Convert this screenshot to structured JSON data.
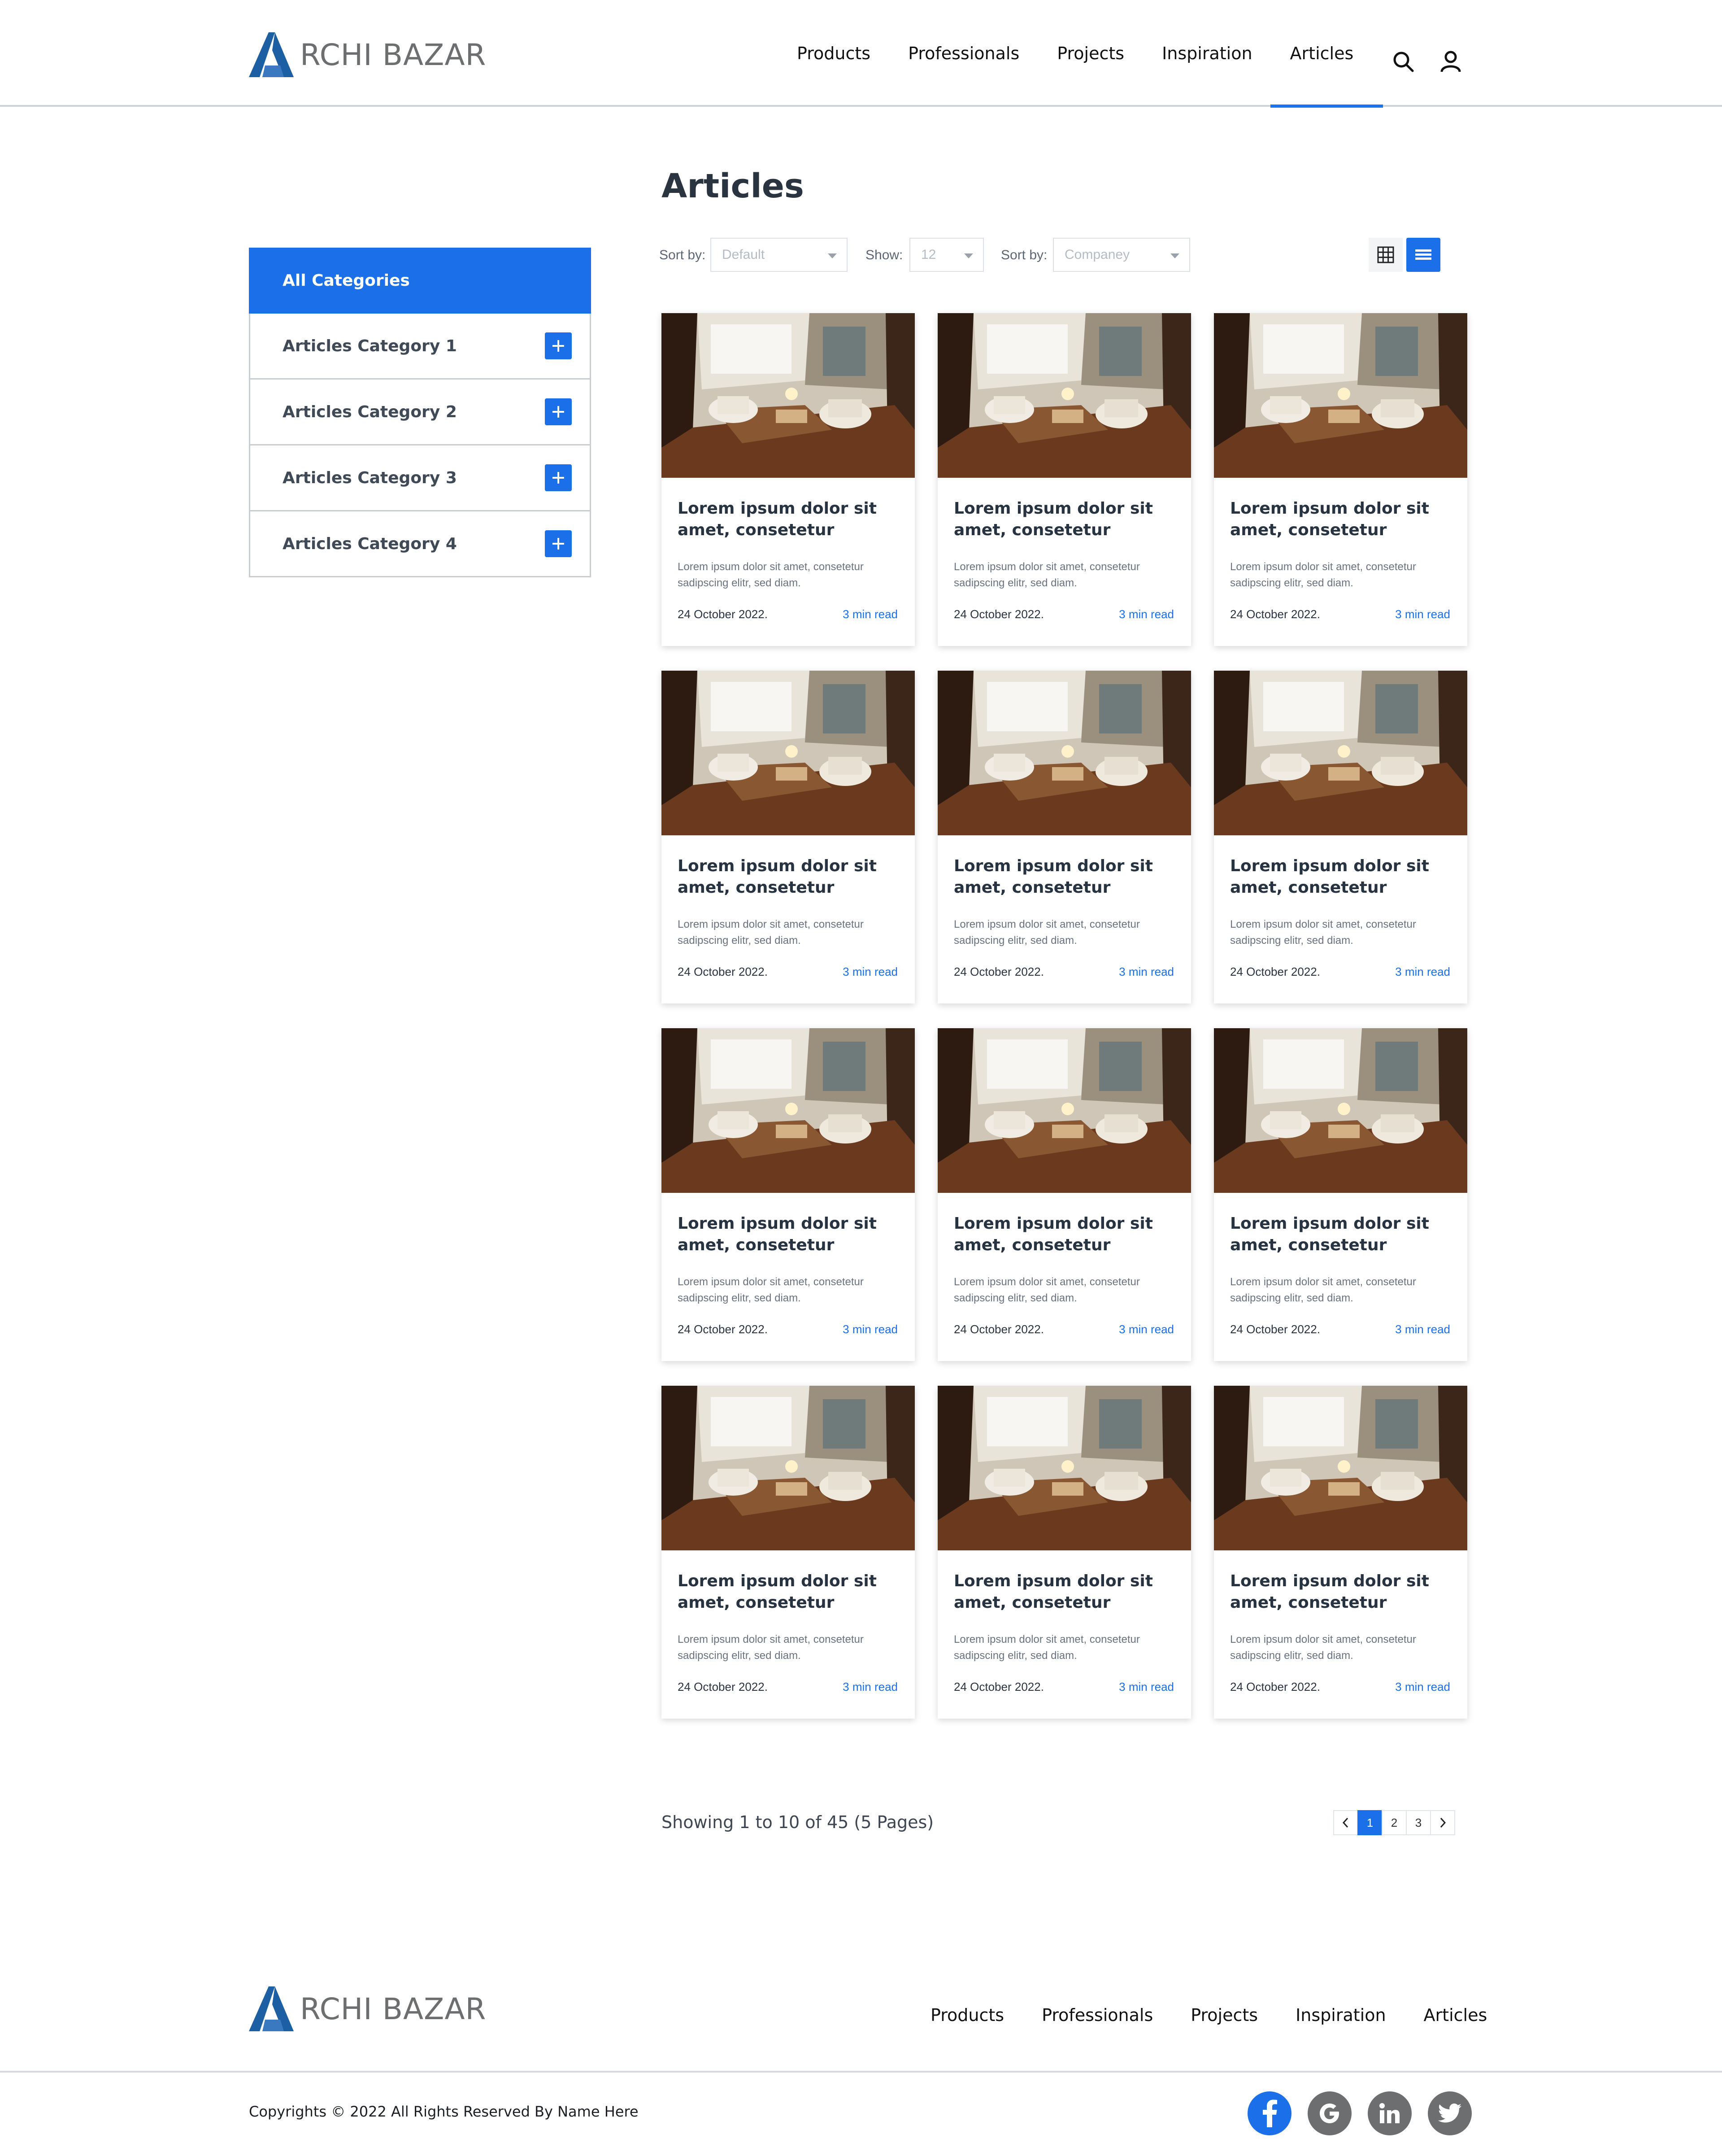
{
  "brand": {
    "name": "RCHI BAZAR"
  },
  "nav": {
    "items": [
      "Products",
      "Professionals",
      "Projects",
      "Inspiration",
      "Articles"
    ],
    "active": "Articles"
  },
  "sidebar": {
    "items": [
      {
        "label": "All Categories"
      },
      {
        "label": "Articles Category 1"
      },
      {
        "label": "Articles Category 2"
      },
      {
        "label": "Articles Category 3"
      },
      {
        "label": "Articles Category 4"
      }
    ]
  },
  "page": {
    "title": "Articles"
  },
  "toolbar": {
    "sort_label": "Sort by:",
    "sort_value": "Default",
    "show_label": "Show:",
    "show_value": "12",
    "sort2_label": "Sort by:",
    "sort2_value": "Companey"
  },
  "cards": [
    {
      "title": "Lorem ipsum dolor sit amet, consetetur",
      "desc": "Lorem ipsum dolor sit amet, consetetur sadipscing elitr, sed diam.",
      "date": "24 October 2022.",
      "read": "3 min read"
    },
    {
      "title": "Lorem ipsum dolor sit amet, consetetur",
      "desc": "Lorem ipsum dolor sit amet, consetetur sadipscing elitr, sed diam.",
      "date": "24 October 2022.",
      "read": "3 min read"
    },
    {
      "title": "Lorem ipsum dolor sit amet, consetetur",
      "desc": "Lorem ipsum dolor sit amet, consetetur sadipscing elitr, sed diam.",
      "date": "24 October 2022.",
      "read": "3 min read"
    },
    {
      "title": "Lorem ipsum dolor sit amet, consetetur",
      "desc": "Lorem ipsum dolor sit amet, consetetur sadipscing elitr, sed diam.",
      "date": "24 October 2022.",
      "read": "3 min read"
    },
    {
      "title": "Lorem ipsum dolor sit amet, consetetur",
      "desc": "Lorem ipsum dolor sit amet, consetetur sadipscing elitr, sed diam.",
      "date": "24 October 2022.",
      "read": "3 min read"
    },
    {
      "title": "Lorem ipsum dolor sit amet, consetetur",
      "desc": "Lorem ipsum dolor sit amet, consetetur sadipscing elitr, sed diam.",
      "date": "24 October 2022.",
      "read": "3 min read"
    },
    {
      "title": "Lorem ipsum dolor sit amet, consetetur",
      "desc": "Lorem ipsum dolor sit amet, consetetur sadipscing elitr, sed diam.",
      "date": "24 October 2022.",
      "read": "3 min read"
    },
    {
      "title": "Lorem ipsum dolor sit amet, consetetur",
      "desc": "Lorem ipsum dolor sit amet, consetetur sadipscing elitr, sed diam.",
      "date": "24 October 2022.",
      "read": "3 min read"
    },
    {
      "title": "Lorem ipsum dolor sit amet, consetetur",
      "desc": "Lorem ipsum dolor sit amet, consetetur sadipscing elitr, sed diam.",
      "date": "24 October 2022.",
      "read": "3 min read"
    },
    {
      "title": "Lorem ipsum dolor sit amet, consetetur",
      "desc": "Lorem ipsum dolor sit amet, consetetur sadipscing elitr, sed diam.",
      "date": "24 October 2022.",
      "read": "3 min read"
    },
    {
      "title": "Lorem ipsum dolor sit amet, consetetur",
      "desc": "Lorem ipsum dolor sit amet, consetetur sadipscing elitr, sed diam.",
      "date": "24 October 2022.",
      "read": "3 min read"
    },
    {
      "title": "Lorem ipsum dolor sit amet, consetetur",
      "desc": "Lorem ipsum dolor sit amet, consetetur sadipscing elitr, sed diam.",
      "date": "24 October 2022.",
      "read": "3 min read"
    }
  ],
  "pagination": {
    "summary": "Showing 1 to 10 of 45 (5 Pages)",
    "pages": [
      "1",
      "2",
      "3"
    ],
    "current": "1"
  },
  "footer": {
    "nav": [
      "Products",
      "Professionals",
      "Projects",
      "Inspiration",
      "Articles"
    ],
    "copyright": "Copyrights © 2022 All Rights Reserved By Name Here",
    "social": [
      "facebook-icon",
      "google-icon",
      "linkedin-icon",
      "twitter-icon"
    ]
  },
  "colors": {
    "accent": "#1b6fe8",
    "text": "#283342",
    "logo": "#1d5fa3"
  }
}
